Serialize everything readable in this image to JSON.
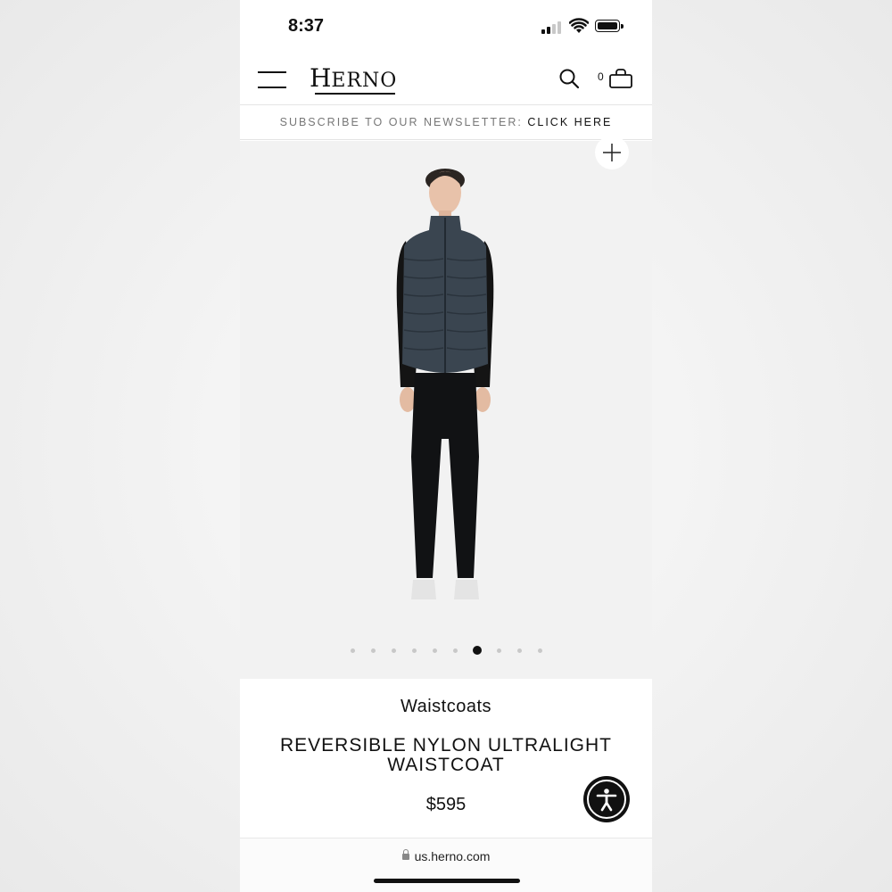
{
  "status_bar": {
    "time": "8:37"
  },
  "header": {
    "logo": "HERNO",
    "logo_first": "H",
    "logo_rest": "ERNO",
    "cart_count": "0",
    "icons": [
      "menu-icon",
      "search-icon",
      "bag-icon"
    ]
  },
  "newsletter": {
    "label": "SUBSCRIBE TO OUR NEWSLETTER:",
    "link": "CLICK HERE"
  },
  "gallery": {
    "slide_count": 10,
    "active_slide": 7
  },
  "product": {
    "category": "Waistcoats",
    "title": "REVERSIBLE NYLON ULTRALIGHT WAISTCOAT",
    "price": "$595"
  },
  "browser": {
    "url": "us.herno.com"
  },
  "colors": {
    "text": "#111111",
    "gallery_bg": "#f2f2f2",
    "accessibility_button": "#111111"
  }
}
